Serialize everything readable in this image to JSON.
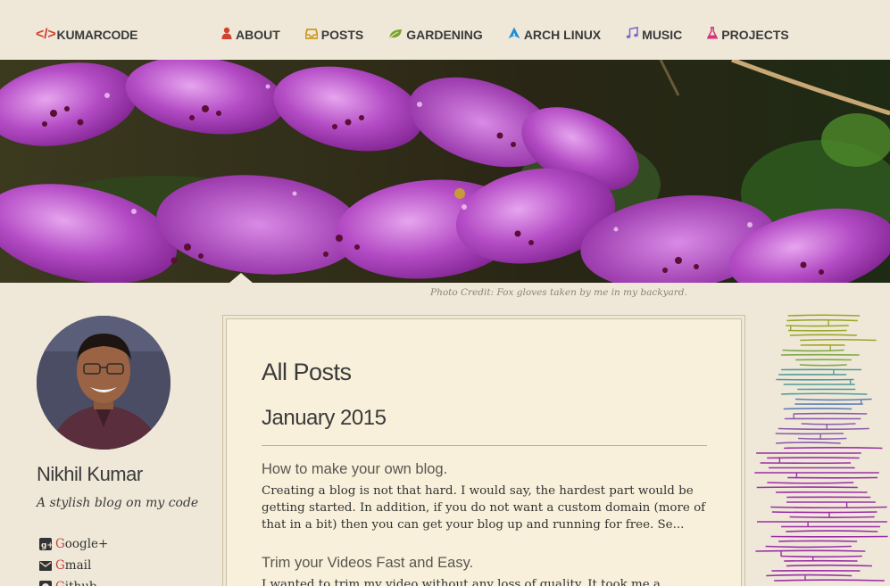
{
  "header": {
    "logo_mark": "</>",
    "logo_text": "KUMARCODE",
    "nav": [
      {
        "label": "ABOUT",
        "icon": "user-icon",
        "color": "#d0432f"
      },
      {
        "label": "POSTS",
        "icon": "inbox-icon",
        "color": "#c99a1c"
      },
      {
        "label": "GARDENING",
        "icon": "leaf-icon",
        "color": "#7aa42b"
      },
      {
        "label": "ARCH LINUX",
        "icon": "arch-linux-icon",
        "color": "#1d8fd6"
      },
      {
        "label": "MUSIC",
        "icon": "music-icon",
        "color": "#7d6bc9"
      },
      {
        "label": "PROJECTS",
        "icon": "flask-icon",
        "color": "#d6337a"
      }
    ]
  },
  "banner": {
    "caption": "Photo Credit: Fox gloves taken by me in my backyard."
  },
  "sidebar": {
    "name": "Nikhil Kumar",
    "tagline": "A stylish blog on my code",
    "links": [
      {
        "first": "G",
        "rest": "oogle+",
        "icon": "google-plus-icon"
      },
      {
        "first": "G",
        "rest": "mail",
        "icon": "mail-icon"
      },
      {
        "first": "G",
        "rest": "ithub",
        "icon": "github-icon"
      }
    ]
  },
  "main": {
    "title": "All Posts",
    "month": "January 2015",
    "posts": [
      {
        "title": "How to make your own blog.",
        "excerpt": "Creating a blog is not that hard. I would say, the hardest part would be getting started. In addition, if you do not want a custom domain (more of that in a bit) then you can get your blog up and running for free. Se..."
      },
      {
        "title": "Trim your Videos Fast and Easy.",
        "excerpt": "I wanted to trim my video without any loss of quality. It took me a surprisingly"
      }
    ]
  },
  "colors": {
    "background": "#efe8d8",
    "card": "#f8f0da",
    "accent": "#d0432f"
  }
}
